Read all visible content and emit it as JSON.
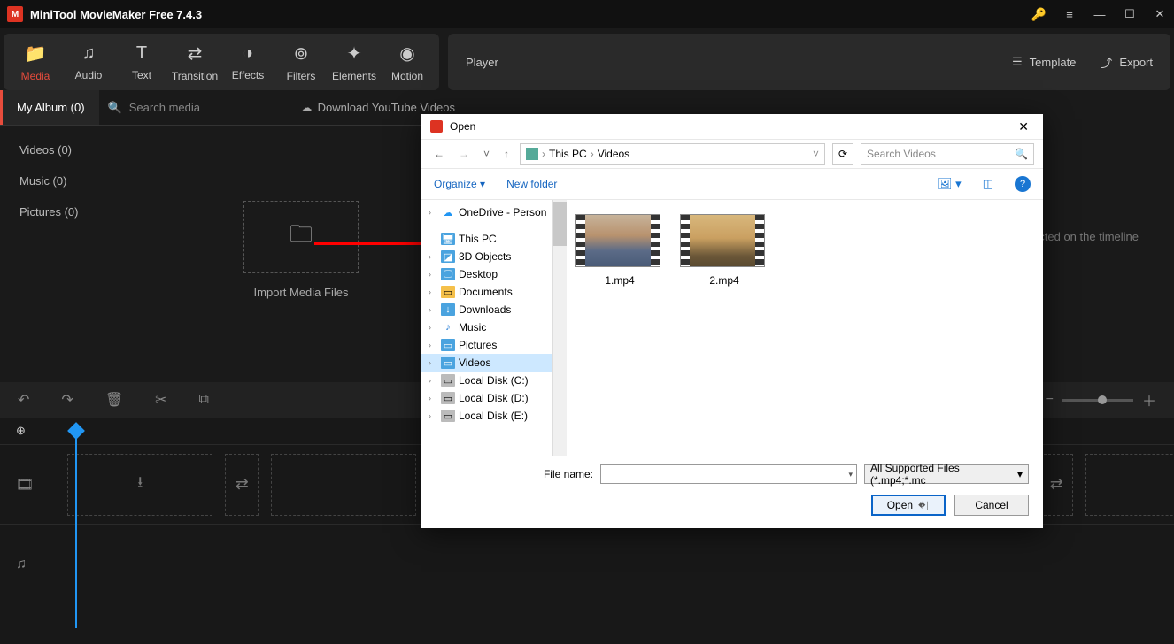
{
  "app": {
    "title": "MiniTool MovieMaker Free 7.4.3"
  },
  "toolbar": {
    "media": "Media",
    "audio": "Audio",
    "text": "Text",
    "transition": "Transition",
    "effects": "Effects",
    "filters": "Filters",
    "elements": "Elements",
    "motion": "Motion"
  },
  "player": {
    "label": "Player",
    "template": "Template",
    "export": "Export"
  },
  "media_panel": {
    "tab_my_album": "My Album (0)",
    "search_placeholder": "Search media",
    "download_yt": "Download YouTube Videos",
    "side": {
      "videos": "Videos (0)",
      "music": "Music (0)",
      "pictures": "Pictures (0)"
    },
    "import_label": "Import Media Files"
  },
  "preview": {
    "hint": "cted on the timeline"
  },
  "dialog": {
    "title": "Open",
    "crumb": {
      "pc": "This PC",
      "videos": "Videos"
    },
    "search_placeholder": "Search Videos",
    "organize": "Organize",
    "new_folder": "New folder",
    "tree": {
      "onedrive": "OneDrive - Person",
      "this_pc": "This PC",
      "objects3d": "3D Objects",
      "desktop": "Desktop",
      "documents": "Documents",
      "downloads": "Downloads",
      "music": "Music",
      "pictures": "Pictures",
      "videos": "Videos",
      "disk_c": "Local Disk (C:)",
      "disk_d": "Local Disk (D:)",
      "disk_e": "Local Disk (E:)"
    },
    "files": [
      {
        "name": "1.mp4",
        "grad": "linear-gradient(180deg,#c7b39a 0%,#b8926e 40%,#5b6b87 70%,#4a5b77 100%)"
      },
      {
        "name": "2.mp4",
        "grad": "linear-gradient(180deg,#d8b77c 0%,#caa061 45%,#6b5738 80%,#5a4a30 100%)"
      }
    ],
    "file_name_label": "File name:",
    "filter": "All Supported Files (*.mp4;*.mc",
    "open_btn": "Open",
    "cancel_btn": "Cancel"
  }
}
